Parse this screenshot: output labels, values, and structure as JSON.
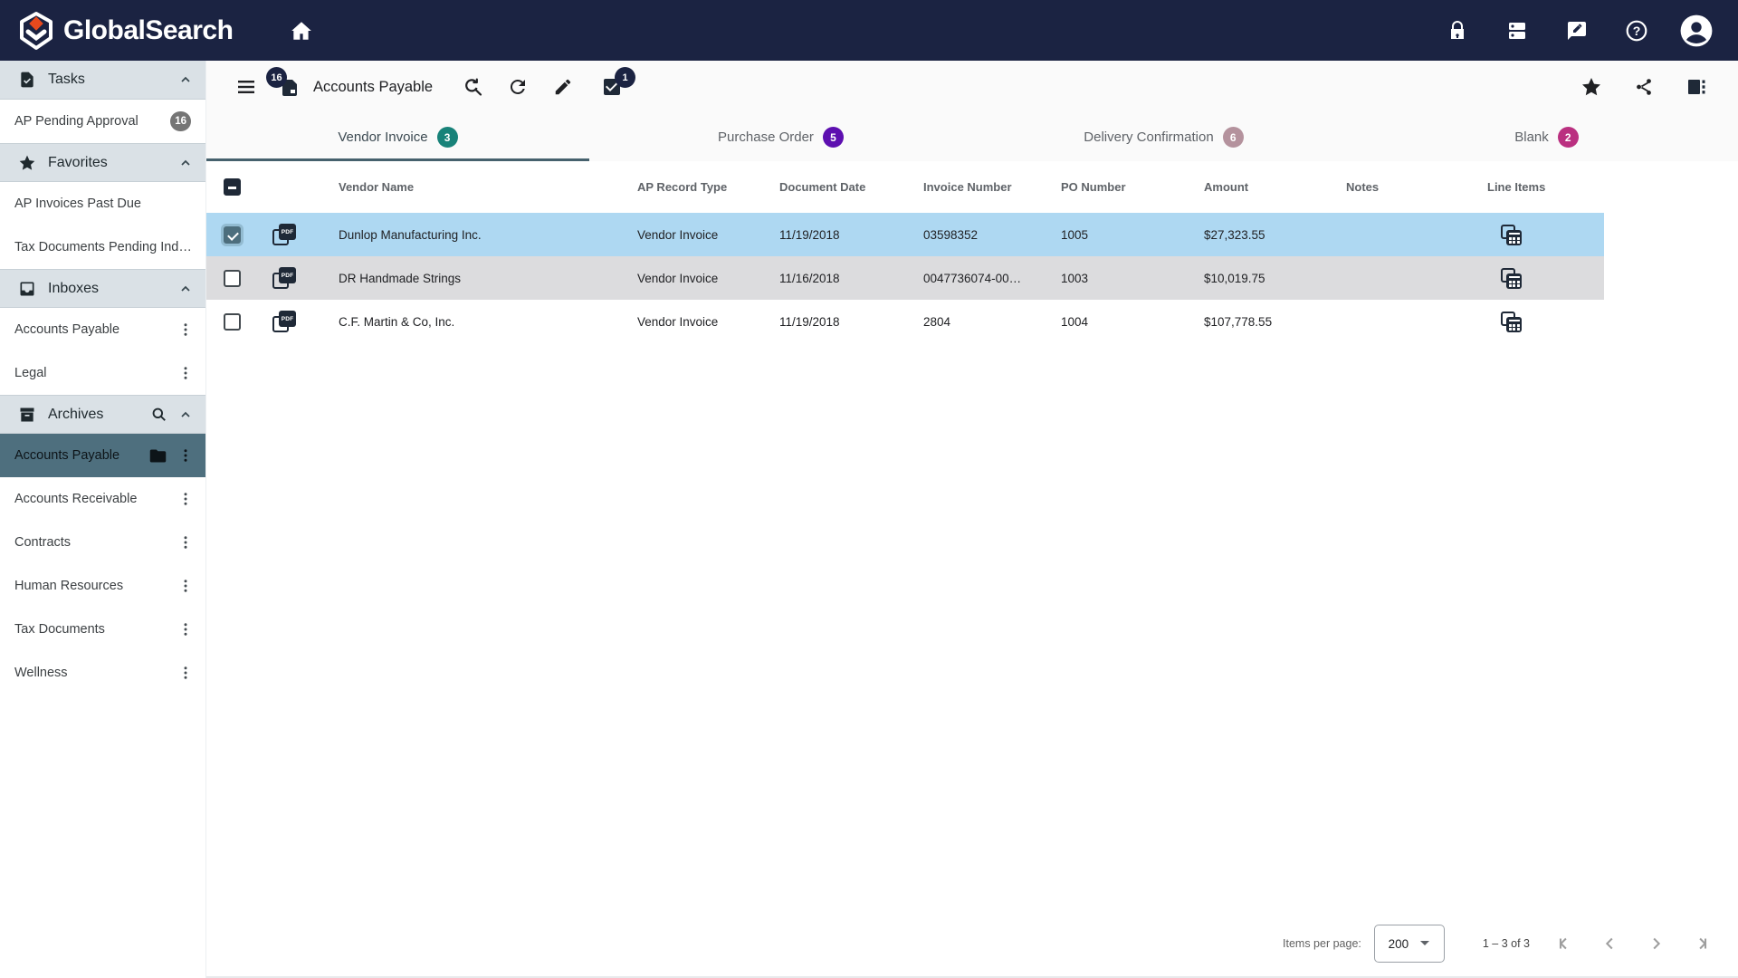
{
  "topbar": {
    "brand": "GlobalSearch",
    "icons": [
      "home",
      "lock",
      "dns",
      "feedback",
      "help",
      "account"
    ]
  },
  "sidebar": {
    "sections": [
      {
        "label": "Tasks",
        "items": [
          {
            "label": "AP Pending Approval",
            "badge": "16"
          }
        ]
      },
      {
        "label": "Favorites",
        "items": [
          {
            "label": "AP Invoices Past Due"
          },
          {
            "label": "Tax Documents Pending Inde…"
          }
        ]
      },
      {
        "label": "Inboxes",
        "items": [
          {
            "label": "Accounts Payable"
          },
          {
            "label": "Legal"
          }
        ]
      },
      {
        "label": "Archives",
        "items": [
          {
            "label": "Accounts Payable",
            "selected": true
          },
          {
            "label": "Accounts Receivable"
          },
          {
            "label": "Contracts"
          },
          {
            "label": "Human Resources"
          },
          {
            "label": "Tax Documents"
          },
          {
            "label": "Wellness"
          }
        ]
      }
    ]
  },
  "toolbar": {
    "title": "Accounts Payable",
    "queue_badge": "16",
    "tagged_badge": "1"
  },
  "tabs": [
    {
      "label": "Vendor Invoice",
      "count": "3",
      "color": "#188279",
      "active": true
    },
    {
      "label": "Purchase Order",
      "count": "5",
      "color": "#5d0fb0"
    },
    {
      "label": "Delivery Confirmation",
      "count": "6",
      "color": "#b4929d"
    },
    {
      "label": "Blank",
      "count": "2",
      "color": "#ba3080"
    }
  ],
  "table": {
    "columns": [
      "Vendor Name",
      "AP Record Type",
      "Document Date",
      "Invoice Number",
      "PO Number",
      "Amount",
      "Notes",
      "Line Items"
    ],
    "rows": [
      {
        "vendor": "Dunlop Manufacturing Inc.",
        "type": "Vendor Invoice",
        "date": "11/19/2018",
        "invoice": "03598352",
        "po": "1005",
        "amount": "$27,323.55",
        "notes": "",
        "selected": true
      },
      {
        "vendor": "DR Handmade Strings",
        "type": "Vendor Invoice",
        "date": "11/16/2018",
        "invoice": "0047736074-00…",
        "po": "1003",
        "amount": "$10,019.75",
        "notes": ""
      },
      {
        "vendor": "C.F. Martin & Co, Inc.",
        "type": "Vendor Invoice",
        "date": "11/19/2018",
        "invoice": "2804",
        "po": "1004",
        "amount": "$107,778.55",
        "notes": ""
      }
    ]
  },
  "pagination": {
    "items_per_page_label": "Items per page:",
    "page_size": "200",
    "range_label": "1 – 3 of 3"
  },
  "colors": {
    "topbar_bg": "#1b2342",
    "selected_row_bg": "#aed8f2",
    "alt_row_bg": "#dcdcde",
    "archive_selected_bg": "#4e6f7e",
    "active_tab_underline": "#46616d",
    "sidebar_badge_bg": "#757575",
    "toolbar_badge_bg": "#1b2342"
  }
}
